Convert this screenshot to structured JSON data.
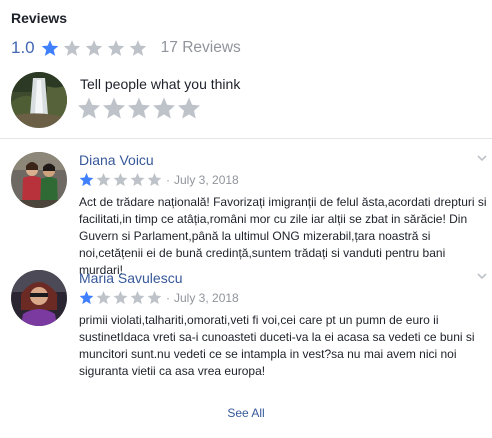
{
  "header": {
    "title": "Reviews"
  },
  "summary": {
    "rating": "1.0",
    "filled_stars": 1,
    "total_stars": 5,
    "review_count": "17 Reviews"
  },
  "compose": {
    "prompt": "Tell people what you think"
  },
  "reviews": [
    {
      "name": "Diana Voicu",
      "stars": 1,
      "separator": "·",
      "date": "July 3, 2018",
      "text": "Act de trădare națională! Favorizați imigranții de felul ăsta,acordati drepturi si facilitati,in timp ce atâția,români mor cu zile iar alții se zbat in sărăcie! Din Guvern si Parlament,până la ultimul ONG mizerabil,țara noastră si noi,cetățenii ei de bună credință,suntem trădați si vanduti pentru bani murdari!"
    },
    {
      "name": "Maria Savulescu",
      "stars": 1,
      "separator": "·",
      "date": "July 3, 2018",
      "text": "primii violati,talhariti,omorati,veti fi voi,cei care pt un pumn de euro ii sustinetIdaca vreti sa-i cunoasteti duceti-va la ei acasa sa vedeti ce buni si muncitori sunt.nu vedeti ce se intampla in vest?sa nu mai avem nici noi siguranta vietii ca asa vrea europa!"
    }
  ],
  "footer": {
    "see_all": "See All"
  },
  "colors": {
    "star_filled": "#4080ff",
    "star_empty": "#bec3c9",
    "link": "#365899",
    "meta": "#90949c"
  },
  "icons": {
    "star": "star-icon",
    "chevron": "chevron-down-icon"
  }
}
